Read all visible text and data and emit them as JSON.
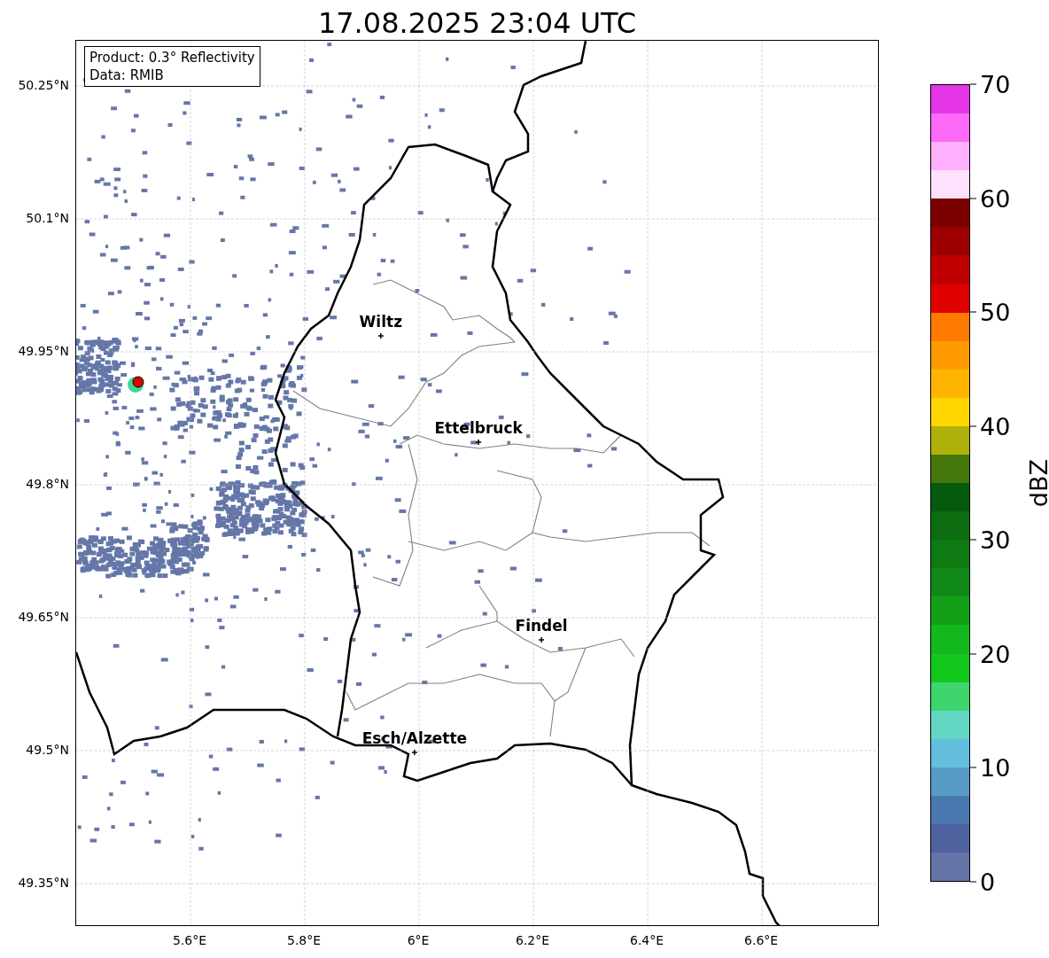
{
  "map": {
    "title": "17.08.2025 23:04 UTC",
    "info_box": {
      "lines": [
        "Product: 0.3° Reflectivity",
        "Data: RMIB"
      ]
    },
    "x_tick_labels": [
      "5.6°E",
      "5.8°E",
      "6°E",
      "6.2°E",
      "6.4°E",
      "6.6°E"
    ],
    "y_tick_labels": [
      "50.25°N",
      "50.1°N",
      "49.95°N",
      "49.8°N",
      "49.65°N",
      "49.5°N",
      "49.35°N"
    ],
    "cities": [
      {
        "label": "Wiltz"
      },
      {
        "label": "Ettelbruck"
      },
      {
        "label": "Findel"
      },
      {
        "label": "Esch/Alzette"
      }
    ]
  },
  "colorbar": {
    "label": "dBZ",
    "ticks": [
      "70",
      "60",
      "50",
      "40",
      "30",
      "20",
      "10",
      "0"
    ],
    "bands": [
      {
        "color": "#e535e8"
      },
      {
        "color": "#fd6af8"
      },
      {
        "color": "#fdb0fc"
      },
      {
        "color": "#ffe0fd"
      },
      {
        "color": "#7a0000"
      },
      {
        "color": "#9c0000"
      },
      {
        "color": "#c00000"
      },
      {
        "color": "#e00000"
      },
      {
        "color": "#ff7a00"
      },
      {
        "color": "#ff9b00"
      },
      {
        "color": "#ffb400"
      },
      {
        "color": "#ffd600"
      },
      {
        "color": "#b0b00a"
      },
      {
        "color": "#45760b"
      },
      {
        "color": "#065a0e"
      },
      {
        "color": "#0b6c10"
      },
      {
        "color": "#0e7a12"
      },
      {
        "color": "#10891a"
      },
      {
        "color": "#12a019"
      },
      {
        "color": "#12b81d"
      },
      {
        "color": "#12c81d"
      },
      {
        "color": "#3ed56d"
      },
      {
        "color": "#63d6c4"
      },
      {
        "color": "#63bfdd"
      },
      {
        "color": "#589cc6"
      },
      {
        "color": "#4a79b0"
      },
      {
        "color": "#4e62a0"
      },
      {
        "color": "#6474a6"
      }
    ]
  }
}
